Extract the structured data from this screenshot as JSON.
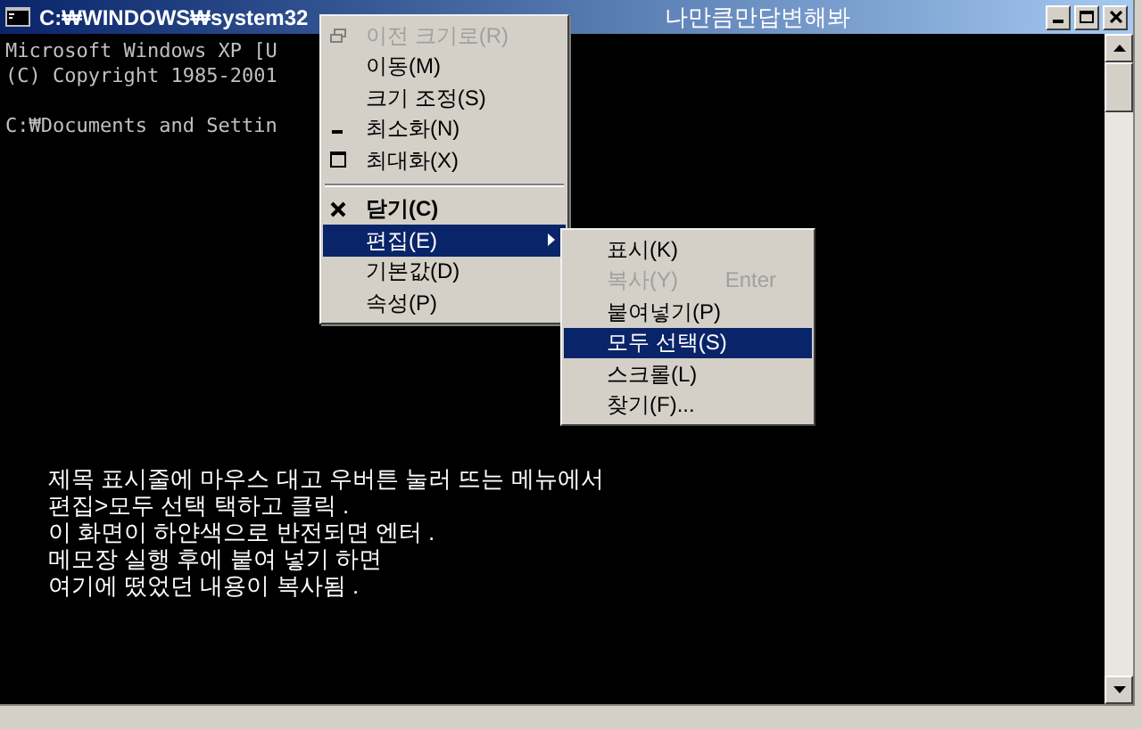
{
  "window": {
    "title": "C:₩WINDOWS₩system32",
    "caption": "나만큼만답변해봐"
  },
  "console": {
    "lines": [
      "Microsoft Windows XP [U",
      "(C) Copyright 1985-2001"
    ],
    "prompt": "C:₩Documents and Settin",
    "notes": [
      "제목 표시줄에 마우스 대고 우버튼 눌러 뜨는 메뉴에서",
      "편집>모두 선택 택하고 클릭 .",
      "이 화면이 하얀색으로 반전되면 엔터 .",
      "메모장 실행 후에 붙여 넣기 하면",
      "여기에 떴었던 내용이 복사됨 ."
    ]
  },
  "system_menu": [
    {
      "kind": "restore",
      "label": "이전 크기로(R)",
      "disabled": true,
      "selected": false
    },
    {
      "kind": "plain",
      "label": "이동(M)",
      "disabled": false,
      "selected": false
    },
    {
      "kind": "plain",
      "label": "크기 조정(S)",
      "disabled": false,
      "selected": false
    },
    {
      "kind": "minimize",
      "label": "최소화(N)",
      "disabled": false,
      "selected": false
    },
    {
      "kind": "maximize",
      "label": "최대화(X)",
      "disabled": false,
      "selected": false
    },
    {
      "kind": "separator"
    },
    {
      "kind": "close",
      "label": "닫기(C)",
      "disabled": false,
      "selected": false
    },
    {
      "kind": "submenu",
      "label": "편집(E)",
      "disabled": false,
      "selected": true
    },
    {
      "kind": "plain",
      "label": "기본값(D)",
      "disabled": false,
      "selected": false
    },
    {
      "kind": "plain",
      "label": "속성(P)",
      "disabled": false,
      "selected": false
    }
  ],
  "edit_submenu": [
    {
      "label": "표시(K)",
      "disabled": false,
      "selected": false
    },
    {
      "label": "복사(Y)",
      "shortcut": "Enter",
      "disabled": true,
      "selected": false
    },
    {
      "label": "붙여넣기(P)",
      "disabled": false,
      "selected": false
    },
    {
      "label": "모두 선택(S)",
      "disabled": false,
      "selected": true
    },
    {
      "label": "스크롤(L)",
      "disabled": false,
      "selected": false
    },
    {
      "label": "찾기(F)...",
      "disabled": false,
      "selected": false
    }
  ]
}
